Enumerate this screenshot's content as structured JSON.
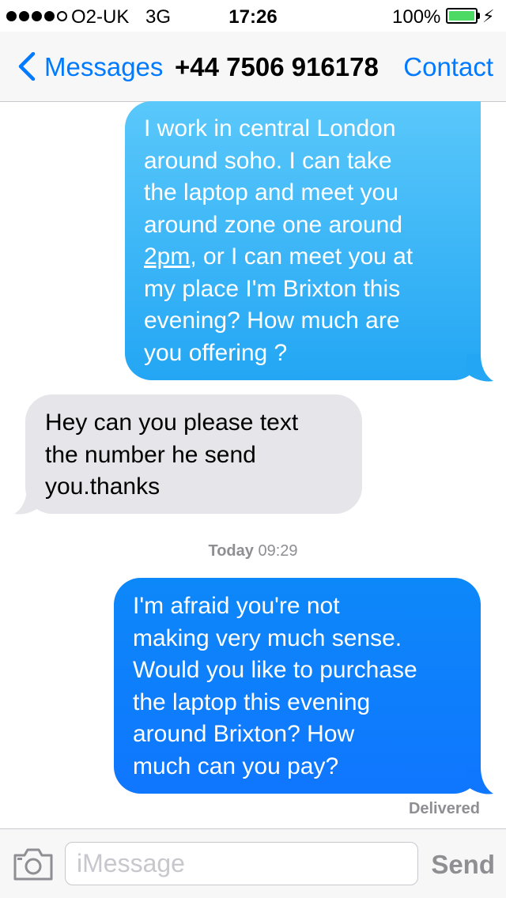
{
  "status_bar": {
    "carrier": "O2-UK",
    "network": "3G",
    "time": "17:26",
    "battery_percent": "100%",
    "signal_bars_filled": 4,
    "signal_bars_total": 5,
    "battery_level": 1.0,
    "charging_icon": "bolt-icon"
  },
  "nav": {
    "back_label": "Messages",
    "title": "+44 7506 916178",
    "contact_label": "Contact",
    "back_icon": "chevron-left-icon"
  },
  "messages": [
    {
      "direction": "outgoing",
      "lines": [
        "I work in central London",
        "around soho. I can take",
        "the laptop and meet you",
        "around zone one around",
        ", or I can meet you at",
        "my place I'm Brixton this",
        "evening? How much are",
        "you offering ?"
      ],
      "link_text": "2pm"
    },
    {
      "direction": "incoming",
      "lines": [
        "Hey can you please text",
        "the number he send",
        "you.thanks"
      ]
    },
    {
      "direction": "outgoing",
      "lines": [
        "I'm afraid you're not",
        "making very much sense.",
        "Would you like to purchase",
        "the laptop this evening",
        "around Brixton? How",
        "much can you pay?"
      ]
    }
  ],
  "timestamp": {
    "day": "Today",
    "time": "09:29"
  },
  "delivered_label": "Delivered",
  "input_bar": {
    "placeholder": "iMessage",
    "value": "",
    "send_label": "Send",
    "camera_icon": "camera-icon"
  },
  "colors": {
    "ios_blue": "#007aff",
    "bubble_light_blue": "#5ac8fa",
    "bubble_blue": "#0f76fe",
    "bubble_gray": "#e5e5ea",
    "battery_green": "#4cd964",
    "meta_gray": "#8e8e93"
  }
}
